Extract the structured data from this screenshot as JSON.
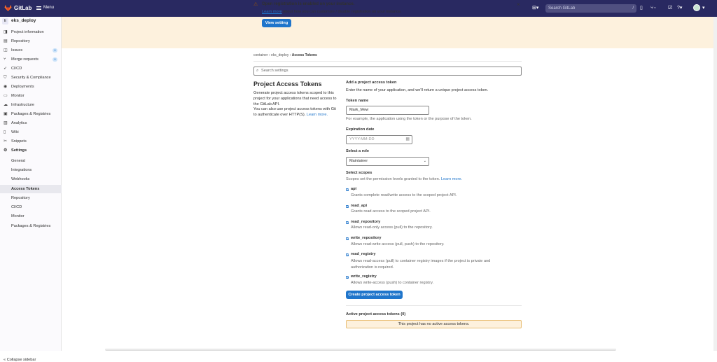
{
  "topbar": {
    "brand": "GitLab",
    "menu_label": "Menu",
    "search_placeholder": "Search GitLab",
    "search_shortcut": "/",
    "icons": [
      "plus-icon",
      "issues-icon",
      "merge-request-icon",
      "todo-icon",
      "help-icon",
      "avatar"
    ]
  },
  "sidebar": {
    "project_badge": "E",
    "project_name": "eks_deploy",
    "items": [
      {
        "label": "Project information",
        "icon": "info-icon"
      },
      {
        "label": "Repository",
        "icon": "book-icon"
      },
      {
        "label": "Issues",
        "icon": "issues-icon",
        "badge": "0"
      },
      {
        "label": "Merge requests",
        "icon": "merge-request-icon",
        "badge": "0"
      },
      {
        "label": "CI/CD",
        "icon": "rocket-icon"
      },
      {
        "label": "Security & Compliance",
        "icon": "shield-icon"
      },
      {
        "label": "Deployments",
        "icon": "deployments-icon"
      },
      {
        "label": "Monitor",
        "icon": "monitor-icon"
      },
      {
        "label": "Infrastructure",
        "icon": "cloud-icon"
      },
      {
        "label": "Packages & Registries",
        "icon": "package-icon"
      },
      {
        "label": "Analytics",
        "icon": "chart-icon"
      },
      {
        "label": "Wiki",
        "icon": "wiki-icon"
      },
      {
        "label": "Snippets",
        "icon": "snippet-icon"
      },
      {
        "label": "Settings",
        "icon": "gear-icon"
      }
    ],
    "settings_subitems": [
      "General",
      "Integrations",
      "Webhooks",
      "Access Tokens",
      "Repository",
      "CI/CD",
      "Monitor",
      "Packages & Registries"
    ],
    "collapse_label": "Collapse sidebar"
  },
  "banner": {
    "title": "Open registration is enabled on your instance.",
    "link_text": "Learn more",
    "text": " about how you can customize / disable registration on your instance.",
    "button": "View setting"
  },
  "breadcrumb": [
    "container",
    "eks_deploy",
    "Access Tokens"
  ],
  "search_settings_placeholder": "Search settings",
  "left": {
    "heading": "Project Access Tokens",
    "desc1": "Generate project access tokens scoped to this project for your applications that need access to the GitLab API.",
    "desc2": "You can also use project access tokens with Git to authenticate over HTTP(S). ",
    "learn_more": "Learn more."
  },
  "form": {
    "heading": "Add a project access token",
    "intro": "Enter the name of your application, and we'll return a unique project access token.",
    "token_name_label": "Token name",
    "token_name_value": "Mark_Mew",
    "token_name_help": "For example, the application using the token or the purpose of the token.",
    "expiration_label": "Expiration date",
    "expiration_placeholder": "YYYY-MM-DD",
    "role_label": "Select a role",
    "role_value": "Maintainer",
    "scopes_label": "Select scopes",
    "scopes_help": "Scopes set the permission levels granted to the token. ",
    "scopes_learn_more": "Learn more.",
    "scopes": [
      {
        "name": "api",
        "desc": "Grants complete read/write access to the scoped project API."
      },
      {
        "name": "read_api",
        "desc": "Grants read access to the scoped project API."
      },
      {
        "name": "read_repository",
        "desc": "Allows read-only access (pull) to the repository."
      },
      {
        "name": "write_repository",
        "desc": "Allows read-write access (pull, push) to the repository."
      },
      {
        "name": "read_registry",
        "desc": "Allows read-access (pull) to container registry images if the project is private and authorization is required."
      },
      {
        "name": "write_registry",
        "desc": "Allows write-access (push) to container registry."
      }
    ],
    "create_button": "Create project access token",
    "active_heading": "Active project access tokens (0)",
    "no_tokens": "This project has no active access tokens."
  },
  "colors": {
    "topbar": "#292961",
    "accent": "#1f75cb",
    "banner": "#fdf1dd"
  }
}
